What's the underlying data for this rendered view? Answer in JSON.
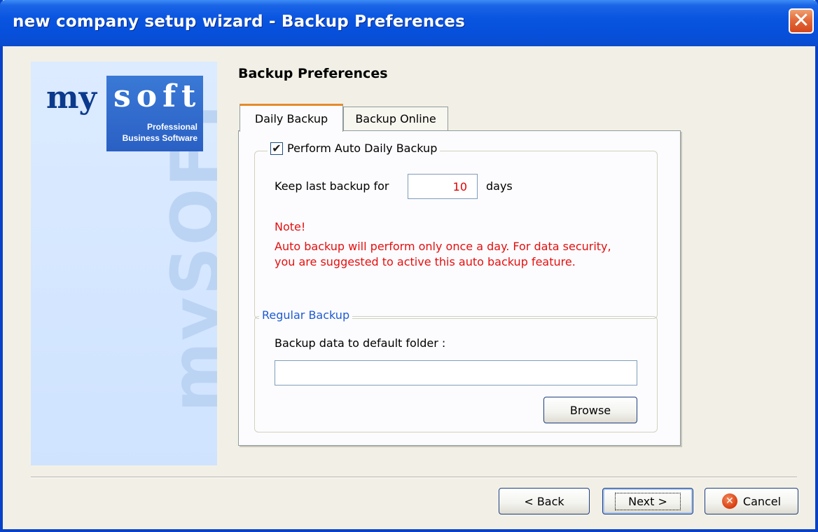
{
  "window": {
    "title": "new company setup wizard - Backup Preferences",
    "close_glyph": "✕"
  },
  "banner": {
    "logo_my": "my",
    "logo_soft": "soft",
    "logo_sub1": "Professional",
    "logo_sub2": "Business Software",
    "vertical_text": "mySOFT"
  },
  "page": {
    "heading": "Backup Preferences"
  },
  "tabs": [
    {
      "label": "Daily Backup",
      "active": true
    },
    {
      "label": "Backup Online",
      "active": false
    }
  ],
  "auto_backup": {
    "legend": "Perform Auto Daily Backup",
    "checked": true,
    "check_glyph": "✔",
    "keep_label": "Keep last backup for",
    "days_value": "10",
    "days_unit": "days",
    "note_title": "Note!",
    "note_line1": "Auto backup will perform only once a day. For data security,",
    "note_line2": "you are suggested to active this auto backup feature."
  },
  "regular_backup": {
    "legend": "Regular Backup",
    "folder_label": "Backup data to default folder :",
    "folder_value": "",
    "browse_label": "Browse"
  },
  "footer": {
    "back_label": "< Back",
    "next_label": "Next >",
    "cancel_label": "Cancel",
    "cancel_icon_glyph": "✕"
  },
  "colors": {
    "title_bar": "#0a55e0",
    "note_text": "#e50f0f",
    "group_legend": "#1f5bd0",
    "active_tab_accent": "#e68b2c"
  }
}
